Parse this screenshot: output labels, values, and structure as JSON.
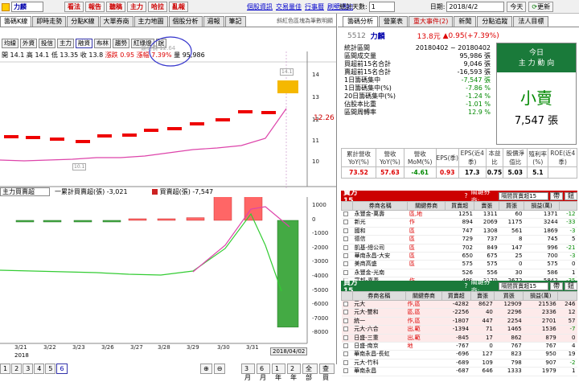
{
  "topbar": {
    "buttons": [
      "看法",
      "報告",
      "聽稿",
      "主力",
      "哈拉",
      "亂報"
    ],
    "links": [
      "個股資訊",
      "交易量佳",
      "行事曆",
      "刷壁通知"
    ]
  },
  "tabs": [
    "籌碼K線",
    "即時走勢",
    "分點K線",
    "大單券商",
    "主力地圖",
    "個股分析",
    "週報",
    "筆記"
  ],
  "stock_header": {
    "name": "力麟",
    "note": "斜紅色區塊為筆數明顯"
  },
  "toolbar": [
    "均線",
    "外資",
    "投信",
    "主力",
    "融資",
    "布林",
    "趨勢",
    "紅綠燈",
    "說"
  ],
  "ohlc": {
    "open_label": "開",
    "open": "14.1",
    "high_label": "高",
    "high": "14.1",
    "low_label": "低",
    "low": "13.35",
    "close_label": "收",
    "close": "13.8",
    "chg_label": "漲跌",
    "chg": "0.95",
    "pct_label": "漲幅",
    "pct": "7.39%",
    "vol_label": "量",
    "vol": "95,986"
  },
  "price_chart": {
    "annot_top": "最高價 12.64",
    "yticks": [
      "14",
      "13",
      "12",
      "11",
      "10"
    ],
    "last_price": "12.26",
    "box_high": "14.1",
    "box_low": "10.1"
  },
  "lower_chart": {
    "selector": "主力買賣超",
    "legend1": "一累計買賣超(張) -3,021",
    "legend2": "買賣超(張) -7,547",
    "yticks": [
      "1000",
      "0",
      "-1000",
      "-2000",
      "-3000",
      "-4000",
      "-5000",
      "-6000",
      "-7000",
      "-8000"
    ],
    "xticks": [
      "3/21",
      "3/22",
      "3/23",
      "3/26",
      "3/27",
      "3/28",
      "3/29",
      "3/30",
      "3/31"
    ],
    "current_date": "2018/04/02",
    "year": "2018"
  },
  "bottom_bar": {
    "pages": [
      "1",
      "2",
      "3",
      "4",
      "5",
      "6"
    ],
    "ranges": [
      "3月",
      "6月",
      "1年",
      "2年",
      "全部",
      "查買"
    ]
  },
  "right_top": {
    "count_label": "統計天數:",
    "count": "1",
    "date_label": "日期:",
    "date": "2018/4/2",
    "today": "今天",
    "refresh": "更新"
  },
  "right_tabs": [
    "籌碼分析",
    "營業表",
    "重大事件(2)",
    "新聞",
    "分點追蹤",
    "法人目標"
  ],
  "quote": {
    "code": "5512",
    "name": "力麟",
    "price": "13.8元",
    "change": "▲0.95",
    "pct": "(+7.39%)"
  },
  "stats": [
    {
      "k": "統計區間",
      "v": "20180402 ~ 20180402"
    },
    {
      "k": "區間成交量",
      "v": "95,986 張"
    },
    {
      "k": "買超前15名合計",
      "v": "9,046 張"
    },
    {
      "k": "賣超前15名合計",
      "v": "-16,593 張"
    },
    {
      "k": "1日籌碼集中",
      "v": "-7,547 張"
    },
    {
      "k": "1日籌碼集中(%)",
      "v": "-7.86 %"
    },
    {
      "k": "20日籌碼集中(%)",
      "v": "-1.24 %"
    },
    {
      "k": "佔股本比重",
      "v": "-1.01 %"
    },
    {
      "k": "區間周轉率",
      "v": "12.9 %"
    }
  ],
  "today_box": {
    "title1": "今日",
    "title2": "主 力 動 向",
    "action": "小賣",
    "amount": "7,547 張"
  },
  "fund": {
    "headers": [
      "累計營收YoY(%)",
      "營收YoY(%)",
      "營收MoM(%)",
      "EPS(季)",
      "EPS(近4季)",
      "本益比",
      "股價淨值比",
      "殖利率(%)",
      "ROE(近4季)"
    ],
    "values": [
      "73.52",
      "57.63",
      "-4.61",
      "0.93",
      "17.3",
      "0.75",
      "5.03",
      "5.1",
      ""
    ]
  },
  "sell_table": {
    "title": "賣方15",
    "filter_label": "關鍵券商:",
    "filter": "隔間買賣超15",
    "go": "帶",
    "nav": "鈕",
    "headers": [
      "券商名稱",
      "關鍵券商",
      "買賣超",
      "賣張",
      "買張",
      "損益(萬)"
    ],
    "rows": [
      [
        "永豐金-萬壽",
        "區,地",
        "1251",
        "1311",
        "60",
        "1371",
        "-12"
      ],
      [
        "新光",
        "作",
        "894",
        "2069",
        "1175",
        "3244",
        "-33"
      ],
      [
        "國和",
        "區",
        "747",
        "1308",
        "561",
        "1869",
        "-3"
      ],
      [
        "德信",
        "區",
        "729",
        "737",
        "8",
        "745",
        "5"
      ],
      [
        "凱基-總公司",
        "區",
        "702",
        "849",
        "147",
        "996",
        "-21"
      ],
      [
        "華南永昌-大安",
        "區",
        "650",
        "675",
        "25",
        "700",
        "-3"
      ],
      [
        "美商高盛",
        "區",
        "575",
        "575",
        "0",
        "575",
        "0"
      ],
      [
        "永豐金-光南",
        "",
        "526",
        "556",
        "30",
        "586",
        "1"
      ],
      [
        "富邦-嘉義",
        "作",
        "498",
        "3170",
        "2672",
        "5842",
        "-35"
      ]
    ]
  },
  "buy_table": {
    "title": "買方15",
    "filter_label": "關鍵券商:",
    "filter": "隔間買賣超15",
    "go": "帶",
    "nav": "鈕",
    "headers": [
      "券商名稱",
      "關鍵券商",
      "買賣超",
      "賣張",
      "買張",
      "損益(萬)"
    ],
    "rows": [
      [
        "元大",
        "作,區",
        "-4282",
        "8627",
        "12909",
        "21536",
        "246"
      ],
      [
        "元大-雙和",
        "區,區",
        "-2256",
        "40",
        "2296",
        "2336",
        "12"
      ],
      [
        "統一",
        "作,區",
        "-1807",
        "447",
        "2254",
        "2701",
        "57"
      ],
      [
        "元大-六合",
        "出,範",
        "-1394",
        "71",
        "1465",
        "1536",
        "-7"
      ],
      [
        "日盛-三重",
        "出,範",
        "-845",
        "17",
        "862",
        "879",
        "0"
      ],
      [
        "日盛-南京",
        "地",
        "-767",
        "0",
        "767",
        "767",
        "4"
      ],
      [
        "華南永昌-長虹",
        "",
        "-696",
        "127",
        "823",
        "950",
        "19"
      ],
      [
        "元大-竹科",
        "",
        "-689",
        "109",
        "798",
        "907",
        "-2"
      ],
      [
        "華南永昌",
        "",
        "-687",
        "646",
        "1333",
        "1979",
        "1"
      ]
    ]
  }
}
